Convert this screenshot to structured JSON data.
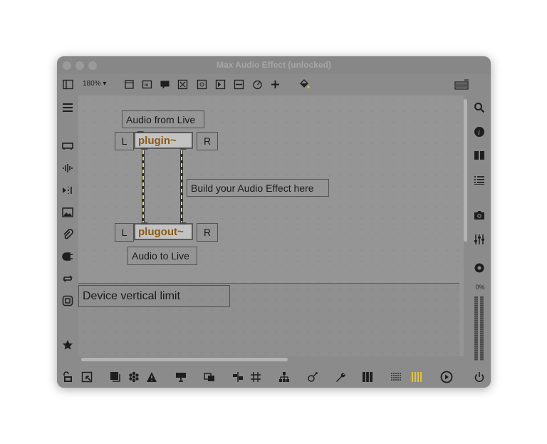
{
  "window": {
    "title": "Max Audio Effect (unlocked)"
  },
  "toolbar": {
    "zoom": "180%",
    "zoom_arrow": "▾"
  },
  "patch": {
    "comment_audio_from": "Audio from Live",
    "comment_build": "Build your Audio Effect here",
    "comment_audio_to": "Audio to Live",
    "device_limit": "Device vertical limit",
    "plugin_label": "plugin~",
    "plugout_label": "plugout~",
    "left_label": "L",
    "right_label": "R"
  },
  "right_sidebar": {
    "meter_label": "0%"
  },
  "colors": {
    "object_text": "#8a5a14",
    "patch_cord": "#d9d97a",
    "meter_active": "#e0c13c",
    "background": "#959595"
  }
}
